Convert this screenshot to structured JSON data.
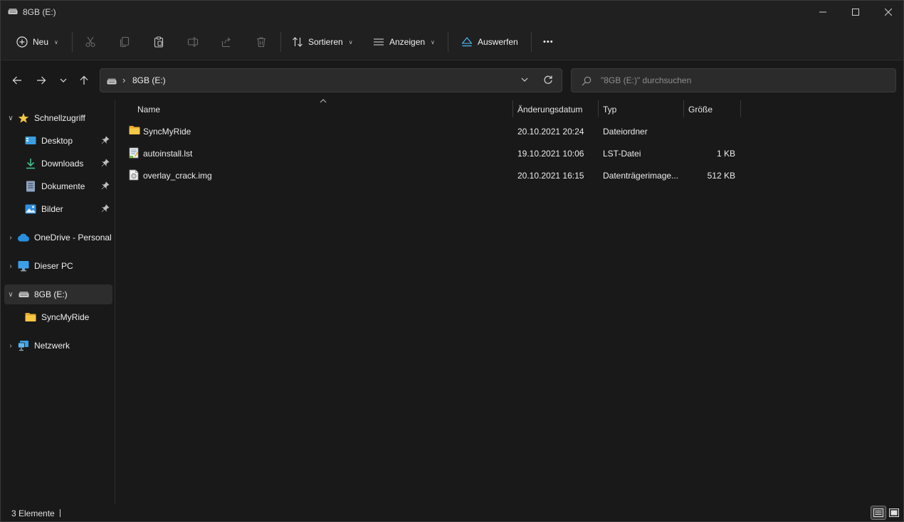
{
  "window": {
    "title": "8GB (E:)"
  },
  "toolbar": {
    "new_label": "Neu",
    "sort_label": "Sortieren",
    "view_label": "Anzeigen",
    "eject_label": "Auswerfen",
    "more_label": "•••"
  },
  "address": {
    "path": "8GB (E:)",
    "search_placeholder": "\"8GB (E:)\" durchsuchen"
  },
  "sidebar": {
    "items": [
      {
        "label": "Schnellzugriff",
        "icon": "star-icon"
      },
      {
        "label": "Desktop",
        "icon": "desktop-icon",
        "pinned": true
      },
      {
        "label": "Downloads",
        "icon": "download-icon",
        "pinned": true
      },
      {
        "label": "Dokumente",
        "icon": "document-icon",
        "pinned": true
      },
      {
        "label": "Bilder",
        "icon": "pictures-icon",
        "pinned": true
      },
      {
        "label": "OneDrive - Personal",
        "icon": "cloud-icon"
      },
      {
        "label": "Dieser PC",
        "icon": "monitor-icon"
      },
      {
        "label": "8GB (E:)",
        "icon": "drive-icon",
        "selected": true
      },
      {
        "label": "SyncMyRide",
        "icon": "folder-icon"
      },
      {
        "label": "Netzwerk",
        "icon": "network-icon"
      }
    ]
  },
  "columns": {
    "name": "Name",
    "modified": "Änderungsdatum",
    "type": "Typ",
    "size": "Größe"
  },
  "files": [
    {
      "name": "SyncMyRide",
      "modified": "20.10.2021 20:24",
      "type": "Dateiordner",
      "size": "",
      "icon": "folder-icon"
    },
    {
      "name": "autoinstall.lst",
      "modified": "19.10.2021 10:06",
      "type": "LST-Datei",
      "size": "1 KB",
      "icon": "text-file-icon"
    },
    {
      "name": "overlay_crack.img",
      "modified": "20.10.2021 16:15",
      "type": "Datenträgerimage...",
      "size": "512 KB",
      "icon": "disk-image-icon"
    }
  ],
  "status": {
    "count": "3 Elemente"
  },
  "colors": {
    "folder": "#f6c744",
    "accent": "#4cc2ff"
  }
}
